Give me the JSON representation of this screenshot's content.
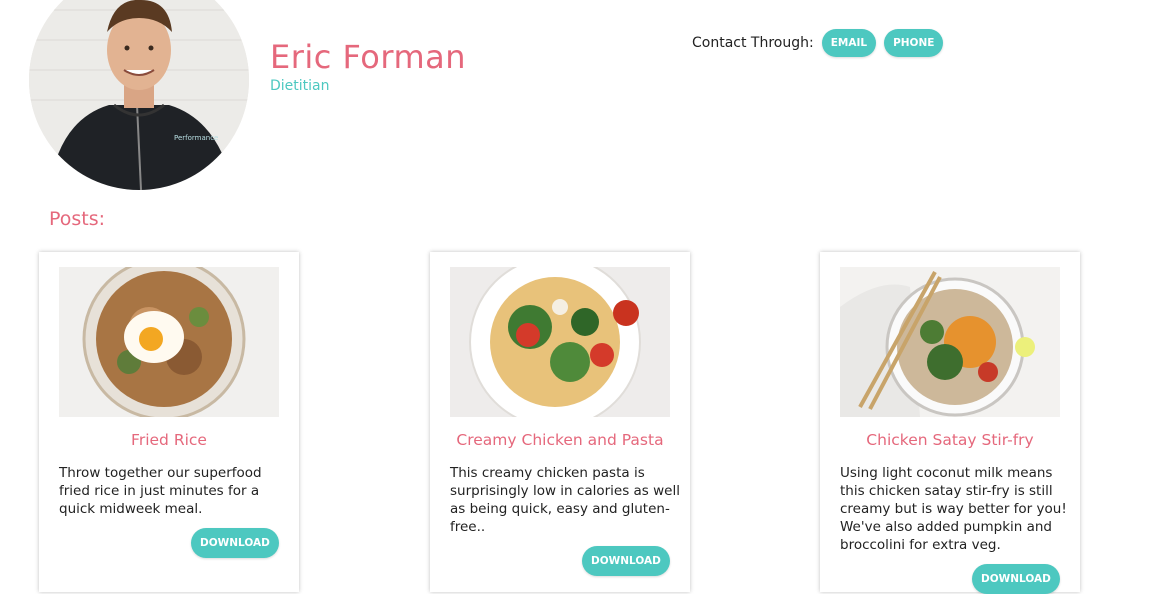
{
  "profile": {
    "name": "Eric Forman",
    "role": "Dietitian"
  },
  "contact": {
    "label": "Contact Through:",
    "email_label": "EMAIL",
    "phone_label": "PHONE"
  },
  "posts": {
    "heading": "Posts:",
    "items": [
      {
        "title": "Fried Rice",
        "description": "Throw together our superfood fried rice in just minutes for a quick midweek meal.",
        "download_label": "DOWNLOAD",
        "image_icon": "fried-rice-photo"
      },
      {
        "title": "Creamy Chicken and Pasta",
        "description": "This creamy chicken pasta is surprisingly low in calories as well as being quick, easy and gluten-free..",
        "download_label": "DOWNLOAD",
        "image_icon": "chicken-pasta-photo"
      },
      {
        "title": "Chicken Satay Stir-fry",
        "description": "Using light coconut milk means this chicken satay stir-fry is still creamy but is way better for you! We've also added pumpkin and broccolini for extra veg.",
        "download_label": "DOWNLOAD",
        "image_icon": "satay-stirfry-photo"
      }
    ]
  },
  "colors": {
    "accent_pink": "#e5687c",
    "accent_teal": "#4dc8c0"
  }
}
